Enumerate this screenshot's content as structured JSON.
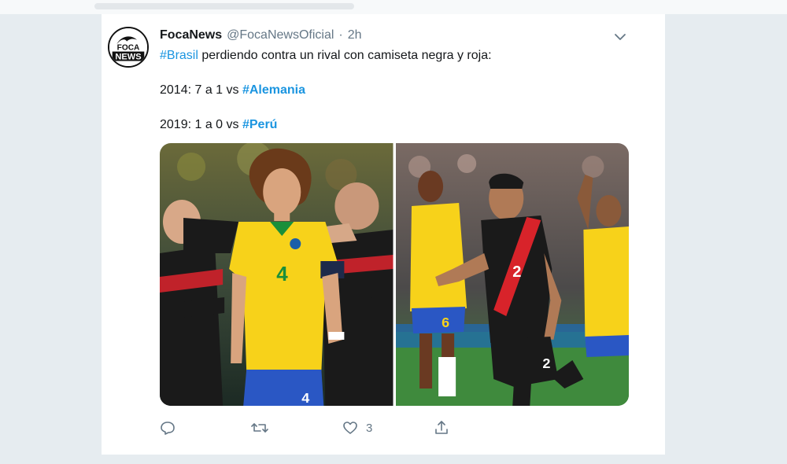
{
  "tweet": {
    "display_name": "FocaNews",
    "handle": "@FocaNewsOficial",
    "separator": "·",
    "time": "2h",
    "avatar_text_top": "FOCA",
    "avatar_text_bottom": "NEWS",
    "line1": {
      "hashtag": "#Brasil",
      "text": " perdiendo contra un rival con camiseta negra y roja:"
    },
    "line2": {
      "text": "2014: 7 a 1 vs ",
      "hashtag": "#Alemania"
    },
    "line3": {
      "text": "2019: 1 a 0 vs ",
      "hashtag": "#Perú"
    },
    "media": [
      {
        "jersey_number": "4",
        "shorts_number": "4"
      },
      {
        "jersey_number": "2",
        "shorts_number": "2",
        "bg_number": "6"
      }
    ],
    "actions": {
      "reply_count": "",
      "retweet_count": "",
      "like_count": "3",
      "share_count": ""
    }
  },
  "colors": {
    "link": "#1b95e0",
    "secondary_text": "#657786",
    "brazil_yellow": "#f7d21a",
    "brazil_green": "#1a8f3a",
    "brazil_blue": "#2a57c4",
    "peru_red": "#d8232a",
    "jersey_black": "#1a1a1a"
  },
  "icons": [
    "chevron-down-icon",
    "reply-icon",
    "retweet-icon",
    "heart-icon",
    "share-icon"
  ]
}
